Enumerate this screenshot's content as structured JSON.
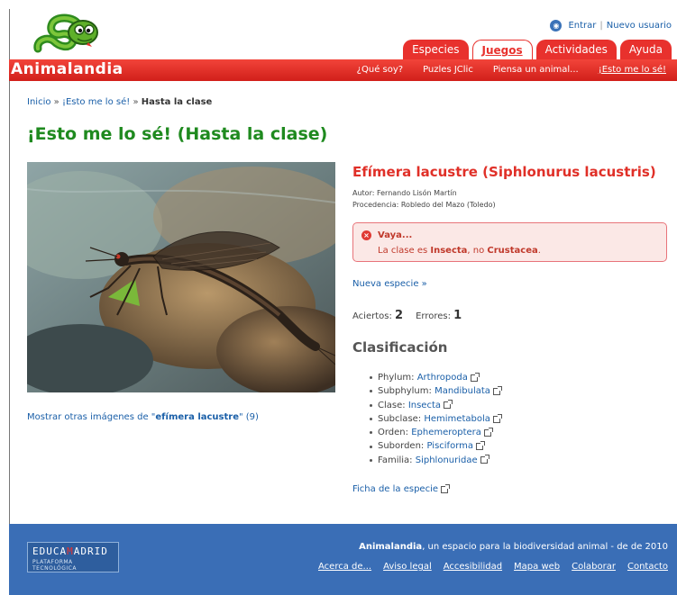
{
  "header": {
    "login": "Entrar",
    "separator": "|",
    "new_user": "Nuevo usuario",
    "brand": "Animalandia",
    "tabs": [
      {
        "label": "Especies"
      },
      {
        "label": "Juegos"
      },
      {
        "label": "Actividades"
      },
      {
        "label": "Ayuda"
      }
    ],
    "subnav": [
      {
        "label": "¿Qué soy?"
      },
      {
        "label": "Puzles JClic"
      },
      {
        "label": "Piensa un animal..."
      },
      {
        "label": "¡Esto me lo sé!"
      }
    ]
  },
  "breadcrumb": {
    "home": "Inicio",
    "sep": "»",
    "section": "¡Esto me lo sé!",
    "current": "Hasta la clase"
  },
  "page_title": "¡Esto me lo sé! (Hasta la clase)",
  "more_images": {
    "prefix": "Mostrar otras imágenes de \"",
    "name": "efímera lacustre",
    "suffix": "\" (9)"
  },
  "species": {
    "title": "Efímera lacustre (Siphlonurus lacustris)",
    "author": "Autor: Fernando Lisón Martín",
    "origin": "Procedencia: Robledo del Mazo (Toledo)"
  },
  "alert": {
    "title": "Vaya...",
    "msg_prefix": "La clase es ",
    "correct": "Insecta",
    "msg_middle": ", no ",
    "wrong": "Crustacea",
    "msg_suffix": "."
  },
  "new_species": "Nueva especie »",
  "score": {
    "hits_label": "Aciertos:",
    "hits": "2",
    "errors_label": "Errores:",
    "errors": "1"
  },
  "classification": {
    "title": "Clasificación",
    "items": [
      {
        "rank": "Phylum:",
        "value": "Arthropoda"
      },
      {
        "rank": "Subphylum:",
        "value": "Mandibulata"
      },
      {
        "rank": "Clase:",
        "value": "Insecta"
      },
      {
        "rank": "Subclase:",
        "value": "Hemimetabola"
      },
      {
        "rank": "Orden:",
        "value": "Ephemeroptera"
      },
      {
        "rank": "Suborden:",
        "value": "Pisciforma"
      },
      {
        "rank": "Familia:",
        "value": "Siphlonuridae"
      }
    ]
  },
  "ficha": "Ficha de la especie",
  "footer": {
    "logo_top_a": "EDUCA",
    "logo_top_m": "M",
    "logo_top_b": "ADRID",
    "logo_bottom": "PLATAFORMA TECNOLÓGICA",
    "brand": "Animalandia",
    "tagline": ", un espacio para la biodiversidad animal - de de 2010",
    "links": [
      {
        "label": "Acerca de..."
      },
      {
        "label": "Aviso legal"
      },
      {
        "label": "Accesibilidad"
      },
      {
        "label": "Mapa web"
      },
      {
        "label": "Colaborar"
      },
      {
        "label": "Contacto"
      }
    ]
  },
  "colors": {
    "brand_red": "#e8312d",
    "title_green": "#1f8a1f",
    "link_blue": "#1a5fa8",
    "footer_blue": "#3a6eb6"
  }
}
